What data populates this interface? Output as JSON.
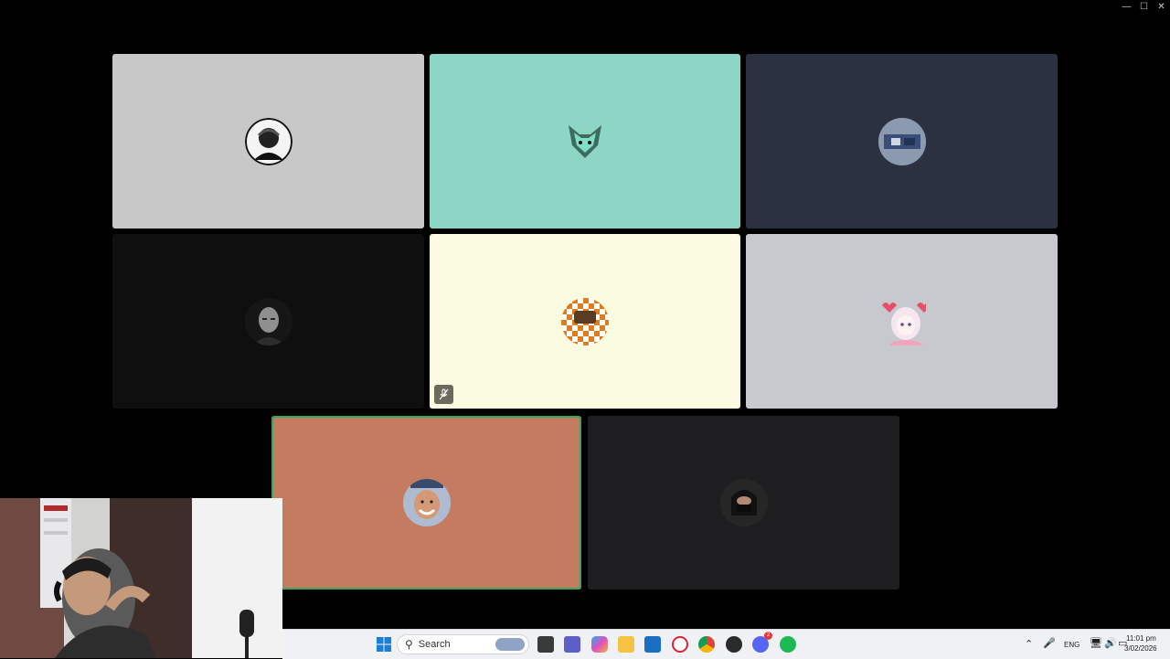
{
  "window": {
    "controls": [
      "minimize-icon",
      "maximize-icon",
      "close-icon"
    ]
  },
  "participants": [
    {
      "bg": "#c8c8c8",
      "avatar_color": "#2b2b2b"
    },
    {
      "bg": "#8dd5c4",
      "avatar_color": "#4fb89a"
    },
    {
      "bg": "#2b3140",
      "avatar_color": "#5b7090"
    },
    {
      "bg": "#0f0f0f",
      "avatar_color": "#3a3a3a"
    },
    {
      "bg": "#fafbe1",
      "avatar_color": "#e27b1a",
      "muted": true
    },
    {
      "bg": "#c8c8cf",
      "avatar_color": "#f1c4d6"
    },
    {
      "bg": "#c47b5f",
      "avatar_color": "#a6b3c8",
      "speaking": true
    },
    {
      "bg": "#1e1e21",
      "avatar_color": "#2a2a2a"
    }
  ],
  "colors": {
    "speaking_border": "#3ba55c",
    "taskbar_bg": "#f0f1f4"
  },
  "taskbar": {
    "search_placeholder": "Search",
    "language": "ENG",
    "time": "11:01 pm",
    "date": "3/02/2026",
    "discord_badge": "2"
  }
}
